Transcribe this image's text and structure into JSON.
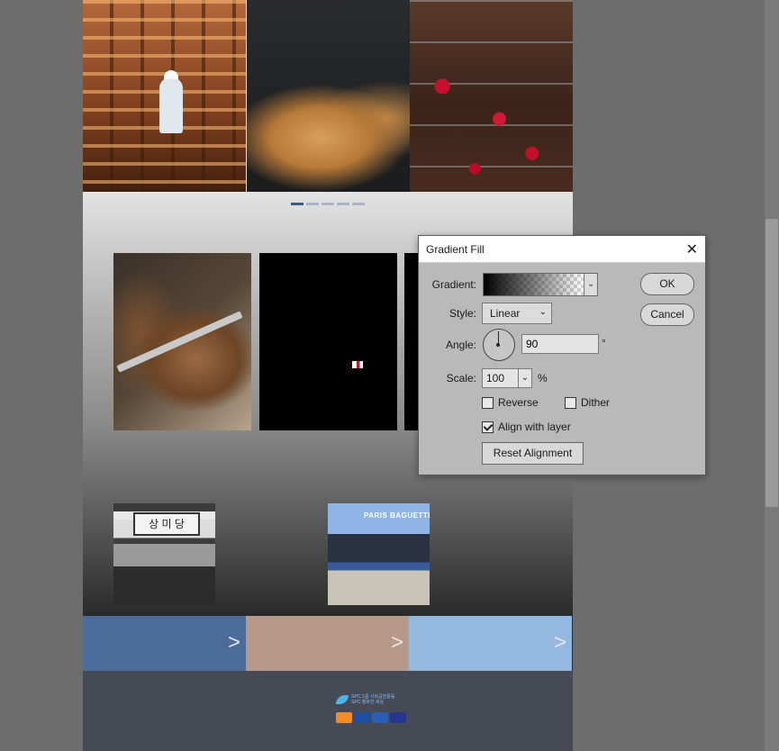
{
  "document": {
    "pager": {
      "count": 5,
      "active_index": 0
    },
    "sign_text": "상 미 당",
    "store_brand": "PARIS BAGUETTE",
    "footer": {
      "group_line1": "SPC그룹 사회공헌활동",
      "group_line2": "SPC 행복한 세상",
      "brand_label": "SPC"
    },
    "banners": [
      {
        "color": "#4b6b9b",
        "chevron": ">"
      },
      {
        "color": "#b89888",
        "chevron": ">"
      },
      {
        "color": "#94b9e0",
        "chevron": ">"
      }
    ]
  },
  "dialog": {
    "title": "Gradient Fill",
    "close_glyph": "✕",
    "gradient_label": "Gradient:",
    "style_label": "Style:",
    "style_value": "Linear",
    "angle_label": "Angle:",
    "angle_value": "90",
    "angle_unit": "°",
    "scale_label": "Scale:",
    "scale_value": "100",
    "scale_unit": "%",
    "reverse_label": "Reverse",
    "reverse_checked": false,
    "dither_label": "Dither",
    "dither_checked": false,
    "align_label": "Align with layer",
    "align_checked": true,
    "reset_button": "Reset Alignment",
    "ok_button": "OK",
    "cancel_button": "Cancel",
    "dropdown_glyph": "⌄"
  }
}
